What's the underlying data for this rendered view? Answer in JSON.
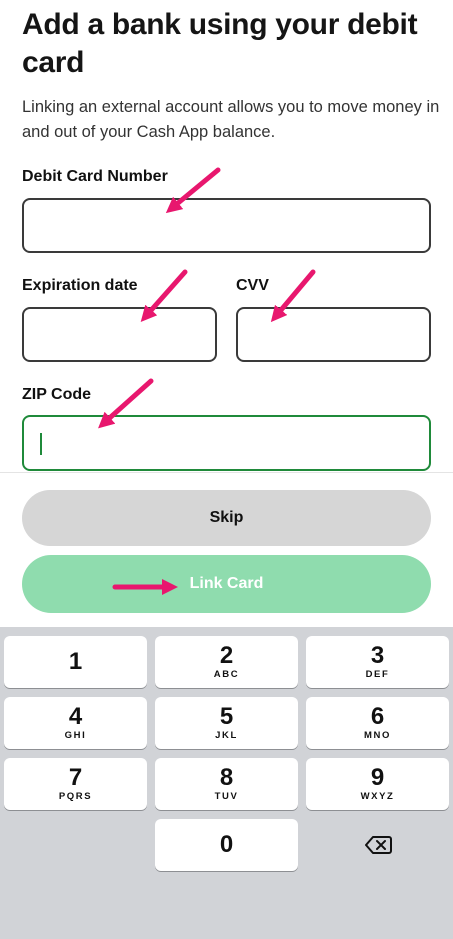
{
  "header": {
    "title": "Add a bank using your debit card",
    "description": "Linking an external account allows you to move money in and out of your Cash App balance."
  },
  "form": {
    "card_number_label": "Debit Card Number",
    "expiration_label": "Expiration date",
    "cvv_label": "CVV",
    "zip_label": "ZIP Code"
  },
  "buttons": {
    "skip_label": "Skip",
    "link_card_label": "Link Card"
  },
  "keypad": {
    "keys": [
      {
        "num": "1",
        "letters": ""
      },
      {
        "num": "2",
        "letters": "ABC"
      },
      {
        "num": "3",
        "letters": "DEF"
      },
      {
        "num": "4",
        "letters": "GHI"
      },
      {
        "num": "5",
        "letters": "JKL"
      },
      {
        "num": "6",
        "letters": "MNO"
      },
      {
        "num": "7",
        "letters": "PQRS"
      },
      {
        "num": "8",
        "letters": "TUV"
      },
      {
        "num": "9",
        "letters": "WXYZ"
      },
      {
        "num": "0",
        "letters": ""
      }
    ],
    "backspace_icon": "backspace-icon"
  },
  "colors": {
    "accent_green": "#1f8a3a",
    "link_button": "#8fdcae",
    "skip_button": "#d6d6d6",
    "annotation_arrow": "#e8176e"
  }
}
